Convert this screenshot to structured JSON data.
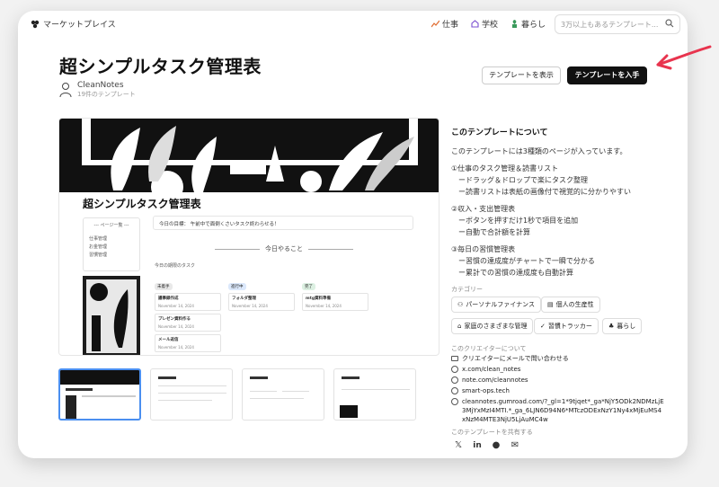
{
  "topbar": {
    "brand": "マーケットプレイス",
    "nav": [
      "仕事",
      "学校",
      "暮らし"
    ],
    "search_placeholder": "3万以上もあるテンプレート..."
  },
  "title": "超シンプルタスク管理表",
  "author": {
    "name": "CleanNotes",
    "count": "19件のテンプレート"
  },
  "buttons": {
    "preview": "テンプレートを表示",
    "get": "テンプレートを入手"
  },
  "preview": {
    "title": "超シンプルタスク管理表",
    "side_head": "--- ページ一覧 ---",
    "side_items": [
      "仕事管理",
      "お金管理",
      "習慣管理"
    ],
    "goal": "今日の目標： 午前中で面倒くさいタスク終わらせる！",
    "today": "今日やること",
    "sub": "今日の期限のタスク",
    "columns": [
      {
        "tag": "未着手",
        "cards": [
          {
            "t": "議事録作成",
            "d": "November 14, 2024"
          },
          {
            "t": "プレゼン資料作る",
            "d": "November 14, 2024"
          },
          {
            "t": "メール返信",
            "d": "November 14, 2024"
          }
        ]
      },
      {
        "tag": "進行中",
        "cards": [
          {
            "t": "フォルダ整理",
            "d": "November 14, 2024"
          }
        ]
      },
      {
        "tag": "完了",
        "cards": [
          {
            "t": "mtg資料準備",
            "d": "November 14, 2024"
          }
        ]
      }
    ]
  },
  "about": {
    "heading": "このテンプレートについて",
    "lines": [
      "このテンプレートには3種類のページが入っています。",
      "①仕事のタスク管理＆読書リスト",
      "ードラッグ＆ドロップで楽にタスク整理",
      "ー読書リストは表紙の画像付で視覚的に分かりやすい",
      "②収入・支出管理表",
      "ーボタンを押すだけ1秒で項目を追加",
      "ー自動で合計額を計算",
      "③毎日の習慣管理表",
      "ー習慣の達成度がチャートで一瞬で分かる",
      "ー累計での習慣の達成度も自動計算"
    ]
  },
  "categories": {
    "heading": "カテゴリー",
    "items": [
      "パーソナルファイナンス",
      "個人の生産性",
      "家庭のさまざまな管理",
      "習慣トラッカー",
      "暮らし"
    ]
  },
  "creator": {
    "heading": "このクリエイターについて",
    "links": [
      "クリエイターにメールで問い合わせる",
      "x.com/clean_notes",
      "note.com/cleannotes",
      "smart-ops.tech",
      "cleannotes.gumroad.com/?_gl=1*9tjqet*_ga*NjY5ODk2NDMzLjE3MjYxMzI4MTI.*_ga_6LJN6D94N6*MTczODExNzY1Ny4xMjEuMS4xNzM4MTE3NjU5LjAuMC4w"
    ]
  },
  "share": {
    "heading": "このテンプレートを共有する"
  },
  "colors": {
    "accent_arrow": "#e8344e",
    "selected_thumb": "#4a8ff0"
  }
}
